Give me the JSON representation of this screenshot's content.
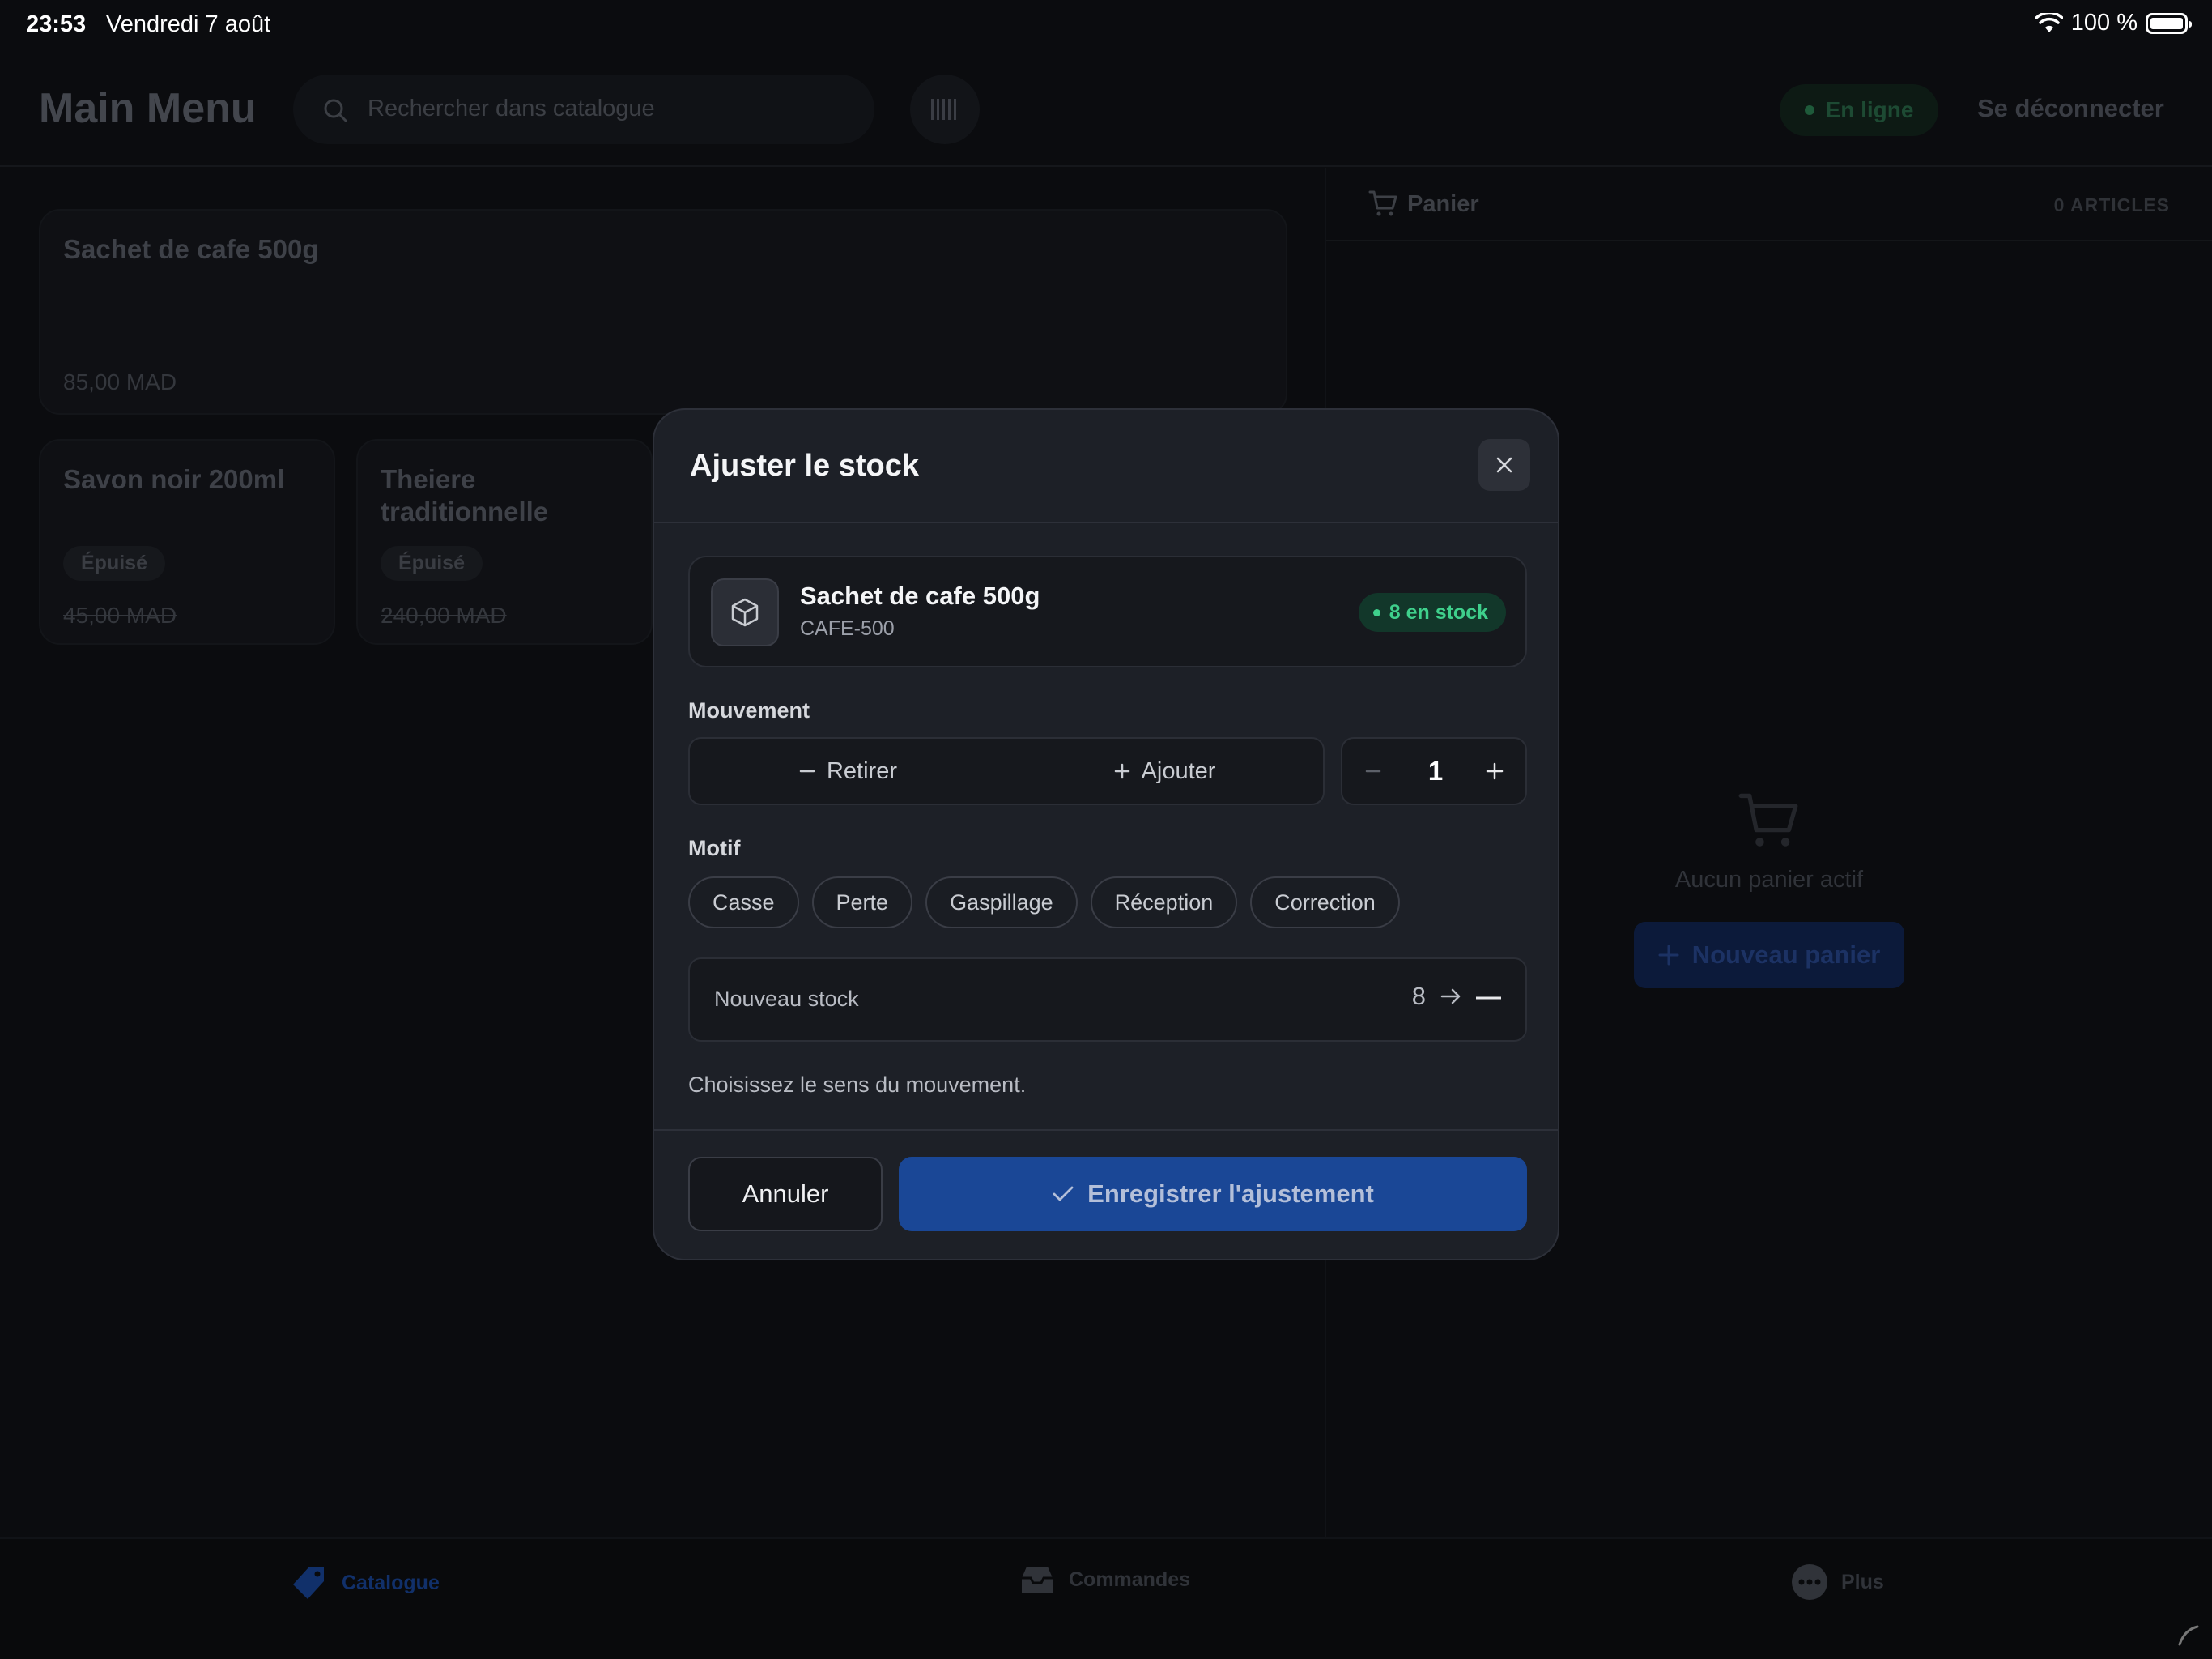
{
  "status_bar": {
    "time": "23:53",
    "date": "Vendredi 7 août",
    "battery": "100 %",
    "icons": [
      "wifi-icon",
      "battery-icon"
    ]
  },
  "header": {
    "title": "Main Menu",
    "search_placeholder": "Rechercher dans catalogue",
    "online_label": "En ligne",
    "logout_label": "Se déconnecter"
  },
  "catalog": {
    "items": [
      {
        "name": "Sachet de cafe 500g",
        "price": "85,00 MAD",
        "badge": ""
      },
      {
        "name": "Savon noir 200ml",
        "price": "45,00 MAD",
        "badge": "Épuisé"
      },
      {
        "name": "Theiere traditionnelle",
        "price": "240,00 MAD",
        "badge": "Épuisé"
      }
    ]
  },
  "cart": {
    "title": "Panier",
    "count": "0 ARTICLES",
    "empty_text": "Aucun panier actif",
    "new_cart_label": "Nouveau panier"
  },
  "tabbar": {
    "tabs": [
      {
        "label": "Catalogue",
        "icon": "tag-icon",
        "active": true
      },
      {
        "label": "Commandes",
        "icon": "inbox-icon",
        "active": false
      },
      {
        "label": "Plus",
        "icon": "more-icon",
        "active": false
      }
    ]
  },
  "modal": {
    "title": "Ajuster le stock",
    "product": {
      "name": "Sachet de cafe 500g",
      "sku": "CAFE-500",
      "stock_badge": "8 en stock"
    },
    "movement_label": "Mouvement",
    "movement_options": {
      "remove": "Retirer",
      "add": "Ajouter"
    },
    "quantity": "1",
    "reason_label": "Motif",
    "reasons": [
      "Casse",
      "Perte",
      "Gaspillage",
      "Réception",
      "Correction"
    ],
    "new_stock_label": "Nouveau stock",
    "new_stock_old": "8",
    "new_stock_new": "—",
    "hint": "Choisissez le sens du mouvement.",
    "cancel_label": "Annuler",
    "save_label": "Enregistrer l'ajustement"
  },
  "colors": {
    "accent": "#1a4796",
    "in_stock": "#3fd08c",
    "modal_bg": "#1d2027"
  }
}
